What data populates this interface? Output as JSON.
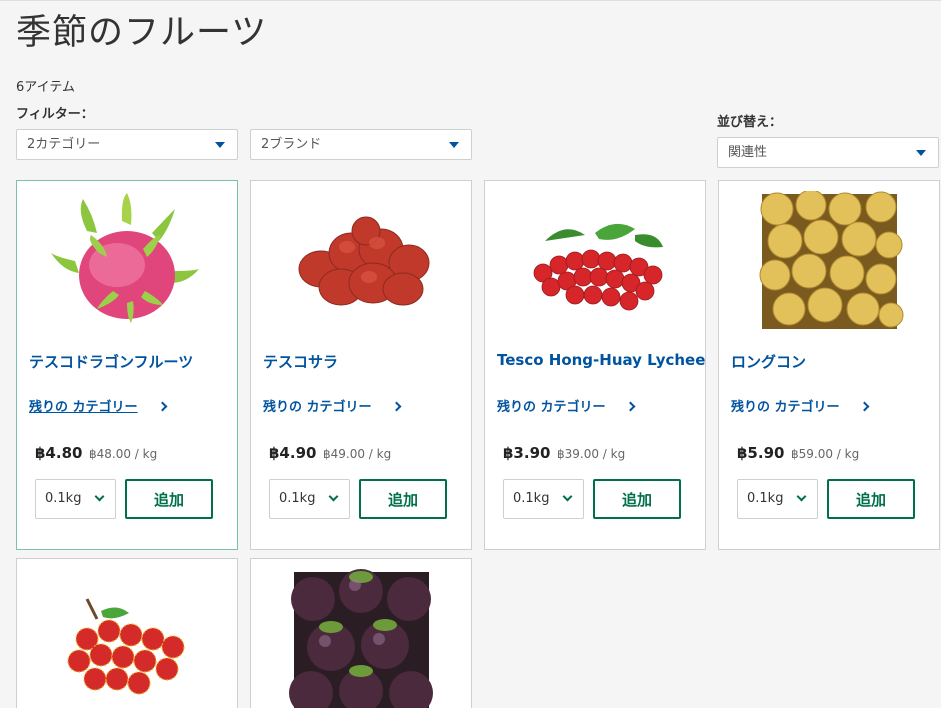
{
  "page": {
    "title": "季節のフルーツ",
    "item_count": "6アイテム"
  },
  "filters": {
    "label": "フィルター：",
    "category": "2カテゴリー",
    "brand": "2ブランド"
  },
  "sort": {
    "label": "並び替え：",
    "value": "関連性"
  },
  "colors": {
    "link_blue": "#00539f",
    "action_green": "#00704a",
    "selected_border": "#7ac3a8"
  },
  "products": [
    {
      "name": "テスコドラゴンフルーツ",
      "category_link": "残りの カテゴリー",
      "price": "฿4.80",
      "unit_price": "฿48.00 / kg",
      "qty": "0.1kg",
      "add_label": "追加"
    },
    {
      "name": "テスコサラ",
      "category_link": "残りの カテゴリー",
      "price": "฿4.90",
      "unit_price": "฿49.00 / kg",
      "qty": "0.1kg",
      "add_label": "追加"
    },
    {
      "name": "Tesco Hong-Huay Lychee",
      "category_link": "残りの カテゴリー",
      "price": "฿3.90",
      "unit_price": "฿39.00 / kg",
      "qty": "0.1kg",
      "add_label": "追加"
    },
    {
      "name": "ロングコン",
      "category_link": "残りの カテゴリー",
      "price": "฿5.90",
      "unit_price": "฿59.00 / kg",
      "qty": "0.1kg",
      "add_label": "追加"
    },
    {
      "name": "",
      "category_link": "",
      "price": "",
      "unit_price": "",
      "qty": "",
      "add_label": ""
    },
    {
      "name": "",
      "category_link": "",
      "price": "",
      "unit_price": "",
      "qty": "",
      "add_label": ""
    }
  ]
}
